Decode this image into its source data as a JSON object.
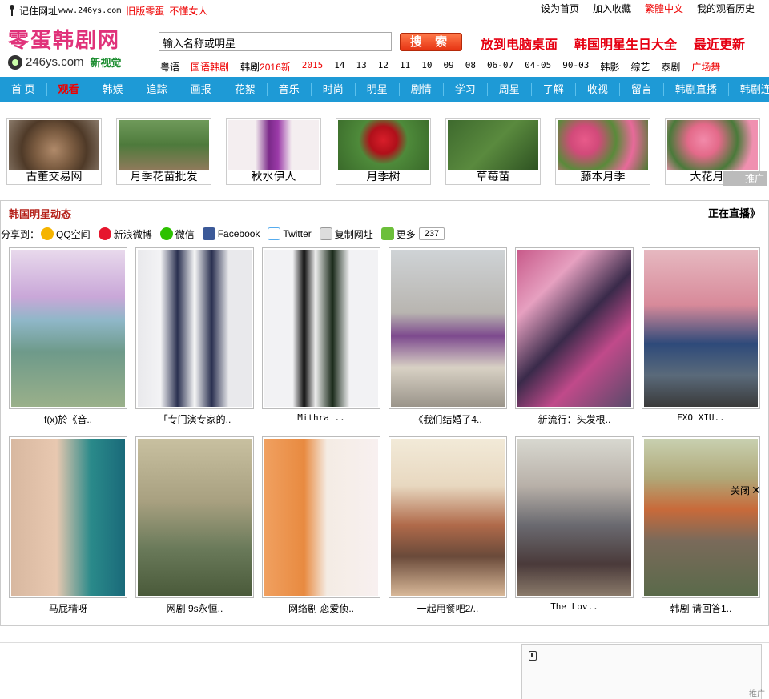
{
  "topbar": {
    "remember": "记住网址",
    "site_url": "www.246ys.com",
    "old_version": "旧版零蛋",
    "not_understand": "不懂女人",
    "links": [
      "设为首页",
      "加入收藏",
      "繁體中文",
      "我的观看历史"
    ]
  },
  "logo": {
    "name": "零蛋韩剧网",
    "domain": "246ys.com",
    "slogan": "新视觉"
  },
  "search": {
    "value": "输入名称或明星",
    "button": "搜 索"
  },
  "header_links": [
    "放到电脑桌面",
    "韩国明星生日大全",
    "最近更新"
  ],
  "categories": [
    "粤语",
    "国语韩剧",
    "韩剧",
    "2016新",
    "2015",
    "14",
    "13",
    "12",
    "11",
    "10",
    "09",
    "08",
    "06-07",
    "04-05",
    "90-03",
    "韩影",
    "综艺",
    "泰剧",
    "广场舞"
  ],
  "nav": [
    "首 页",
    "观看",
    "韩娱",
    "追踪",
    "画报",
    "花絮",
    "音乐",
    "时尚",
    "明星",
    "剧情",
    "学习",
    "周星",
    "了解",
    "收视",
    "留言",
    "韩剧直播",
    "韩剧连载"
  ],
  "ads": [
    "古董交易网",
    "月季花苗批发",
    "秋水伊人",
    "月季树",
    "草莓苗",
    "藤本月季",
    "大花月季"
  ],
  "ad_tag": "推广",
  "section": {
    "title": "韩国明星动态",
    "live": "正在直播》"
  },
  "share": {
    "label": "分享到：",
    "items": [
      "QQ空间",
      "新浪微博",
      "微信",
      "Facebook",
      "Twitter",
      "复制网址",
      "更多"
    ],
    "count": "237"
  },
  "cards": [
    "f(x)於《音..",
    "「专门演专家的..",
    "Mithra ..",
    "《我们结婚了4..",
    "新流行：头发根..",
    "EXO XIU..",
    "马屁精呀",
    "网剧 9s永恒..",
    "网络剧 恋爱侦..",
    "一起用餐吧2/..",
    "The Lov..",
    "韩剧 请回答1.."
  ],
  "close_label": "关闭",
  "bottom_ad_tag": "推广",
  "colors": {
    "nav_bg": "#1e9ad6",
    "accent_red": "#e60012",
    "logo_pink": "#e0327a"
  }
}
